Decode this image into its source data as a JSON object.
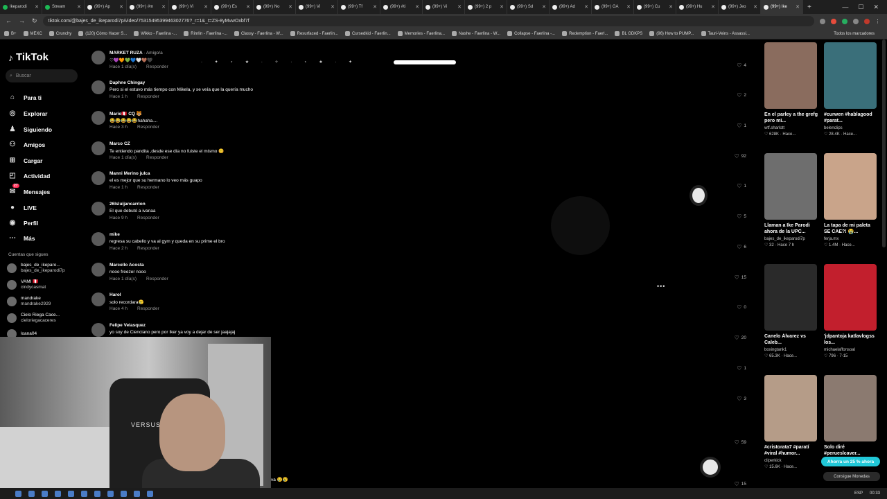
{
  "browser": {
    "tabs": [
      {
        "label": "Ikeparodi",
        "icon": "kick-icon"
      },
      {
        "label": "Stream",
        "icon": "kick-icon"
      },
      {
        "label": "(99+) Ap",
        "icon": "tiktok-icon"
      },
      {
        "label": "(99+) #m",
        "icon": "tiktok-icon"
      },
      {
        "label": "(99+) Vi",
        "icon": "tiktok-icon"
      },
      {
        "label": "(99+) Es",
        "icon": "tiktok-icon"
      },
      {
        "label": "(99+) No",
        "icon": "tiktok-icon"
      },
      {
        "label": "(99+) Vi",
        "icon": "tiktok-icon"
      },
      {
        "label": "(99+) Tf",
        "icon": "tiktok-icon"
      },
      {
        "label": "(99+) #ti",
        "icon": "tiktok-icon"
      },
      {
        "label": "(99+) Vi",
        "icon": "tiktok-icon"
      },
      {
        "label": "(99+) 2 p",
        "icon": "tiktok-icon"
      },
      {
        "label": "(99+) Sd",
        "icon": "tiktok-icon"
      },
      {
        "label": "(99+) Ad",
        "icon": "tiktok-icon"
      },
      {
        "label": "(99+) GA",
        "icon": "tiktok-icon"
      },
      {
        "label": "(99+) Cu",
        "icon": "tiktok-icon"
      },
      {
        "label": "(99+) Hu",
        "icon": "tiktok-icon"
      },
      {
        "label": "(99+) Jeo",
        "icon": "tiktok-icon"
      },
      {
        "label": "(99+) Ike",
        "icon": "tiktok-icon"
      }
    ],
    "new_tab": "+",
    "url": "tiktok.com/@bajes_de_ikeparodi7p/video/7531549539946302776?_r=1&_t=ZS-8yMvwOxbf7f",
    "bookmarks": [
      "B+",
      "MEXC",
      "Crunchy",
      "(120) Cómo Hacer S...",
      "Wikko - Faerlina -...",
      "Rinrlin - Faerlina -...",
      "Classy - Faerlina - W...",
      "Resurfaced - Faerlin...",
      "Cursedkid - Faerlin...",
      "Memories - Faerlina...",
      "Nashe - Faerlina - W...",
      "Collapse - Faerlina -...",
      "Redemption - Faerl...",
      "BL GDKPS",
      "(96) How to PUMP...",
      "Tauri-Veins - Assassi..."
    ],
    "bookmarks_right": "Todos los marcadores"
  },
  "sidebar": {
    "logo": "TikTok",
    "search_placeholder": "Buscar",
    "nav": [
      {
        "label": "Para ti",
        "icon": "home-icon"
      },
      {
        "label": "Explorar",
        "icon": "compass-icon"
      },
      {
        "label": "Siguiendo",
        "icon": "following-icon"
      },
      {
        "label": "Amigos",
        "icon": "friends-icon"
      },
      {
        "label": "Cargar",
        "icon": "upload-icon"
      },
      {
        "label": "Actividad",
        "icon": "activity-icon"
      },
      {
        "label": "Mensajes",
        "icon": "messages-icon",
        "badge": "27"
      },
      {
        "label": "LIVE",
        "icon": "live-icon"
      },
      {
        "label": "Perfil",
        "icon": "profile-icon"
      },
      {
        "label": "Más",
        "icon": "more-icon"
      }
    ],
    "follows_title": "Cuentas que sigues",
    "follows": [
      {
        "name": "bajes_de_ikeparo...",
        "handle": "bajes_de_ikeparodi7p"
      },
      {
        "name": "VAMI 🇵🇪",
        "handle": "cindycasmat"
      },
      {
        "name": "mandrake",
        "handle": "mandrake2929"
      },
      {
        "name": "Cielo Riega Cace...",
        "handle": "cieloriegacaceres"
      },
      {
        "name": "loana04",
        "handle": ""
      }
    ]
  },
  "comments": [
    {
      "name": "MARKET RUZA",
      "tag": "· Amigo/a",
      "text": "♡💜🧡💚💙🤍🤎🖤",
      "time": "Hace 1 día(s)",
      "reply": "Responder",
      "likes": "4"
    },
    {
      "name": "Daphne Chingay",
      "tag": "",
      "text": "Pero si el estuvo más tiempo con Mikela, y se veía que la quería mucho",
      "time": "Hace 1 h",
      "reply": "Responder",
      "likes": "2"
    },
    {
      "name": "Mario🇵🇪 CQ 🐯",
      "tag": "",
      "text": "😂😂😂😂😂hahaha....",
      "time": "Hace 3 h",
      "reply": "Responder",
      "likes": "1"
    },
    {
      "name": "Marco CZ",
      "tag": "",
      "text": "Te entiendo pandita ,desde ese día no fuiste el mismo 😊",
      "time": "Hace 1 día(s)",
      "reply": "Responder",
      "likes": "92"
    },
    {
      "name": "Manni Merino julca",
      "tag": "",
      "text": "el es mejor que su hermano lo veo más guapo",
      "time": "Hace 1 h",
      "reply": "Responder",
      "likes": "1"
    },
    {
      "name": "26lsluijancarrion",
      "tag": "",
      "text": "El que debutó a ivanaa",
      "time": "Hace 9 h",
      "reply": "Responder",
      "likes": "5"
    },
    {
      "name": "mike",
      "tag": "",
      "text": "regresa su cabello y va al gym y queda en su prime el bro",
      "time": "Hace 2 h",
      "reply": "Responder",
      "likes": "6"
    },
    {
      "name": "Marcello Acosta",
      "tag": "",
      "text": "nooo freezer nooo",
      "time": "Hace 1 día(s)",
      "reply": "Responder",
      "likes": "15"
    },
    {
      "name": "Harol",
      "tag": "",
      "text": "solo recordara😢",
      "time": "Hace 4 h",
      "reply": "Responder",
      "likes": "0"
    },
    {
      "name": "Felipe Velasquez",
      "tag": "",
      "text": "yo soy de Cienciano pero por Iker ya voy a dejar de ser jaajajaj",
      "time": "",
      "reply": "",
      "likes": "20"
    }
  ],
  "extra_likes": [
    "1",
    "3",
    "59",
    "15"
  ],
  "more_label": "•••",
  "caption_tail": "va 😢😢",
  "recommendations": [
    {
      "title": "En el parley a the grefg pero mi...",
      "author": "wtf.sharlott",
      "stats": "♡ 628K · Hace...",
      "color": "#8a6c5e"
    },
    {
      "title": "#curwen #hablagood #parat...",
      "author": "belenclips",
      "stats": "♡ 28.4K · Hace...",
      "color": "#3a6f7a"
    },
    {
      "title": "Llaman a Ike Parodi ahora de la UPC...",
      "author": "bajes_de_ikeparodi7p",
      "stats": "♡ 32 · Hace 7 h",
      "color": "#6e6e6e"
    },
    {
      "title": "La tapa de mi paleta SE CAE?! 😭...",
      "author": "ferja.mx",
      "stats": "♡ 1.4M · Hace...",
      "color": "#c9a48a"
    },
    {
      "title": "Canelo Álvarez vs Caleb...",
      "author": "boxingtank1",
      "stats": "♡ 65.3K · Hace...",
      "color": "#2a2a2a"
    },
    {
      "title": "'jdpantoja katlavlogss los...",
      "author": "michaelaffonsoal",
      "stats": "♡ 796 · 7-15",
      "color": "#c21f2d"
    },
    {
      "title": "#cristorata7 #paratí #viral #humor...",
      "author": "cliperkick",
      "stats": "♡ 15.6K · Hace...",
      "color": "#b59c88"
    },
    {
      "title": "Solo diré #perueslcaver...",
      "author": "",
      "stats": "",
      "color": "#8b7a70"
    }
  ],
  "promo": "Ahorra un 25 % ahora",
  "coins": "Consigue Monedas",
  "taskbar": {
    "lang": "ESP",
    "time": "00:33"
  },
  "webcam": {
    "chair_brand": "VERSUS"
  }
}
